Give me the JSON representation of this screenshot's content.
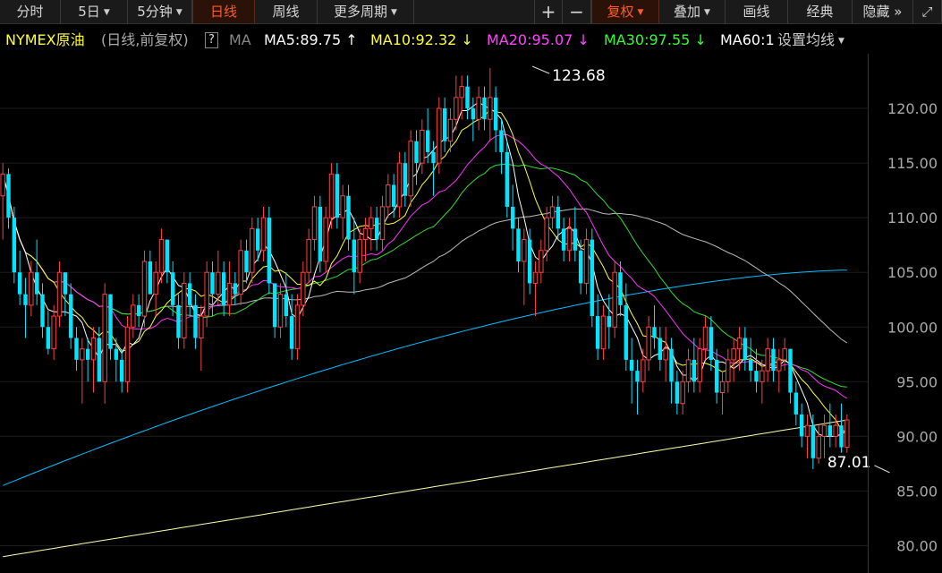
{
  "toolbar": {
    "left": [
      {
        "label": "分时"
      },
      {
        "label": "5日",
        "dropdown": true
      },
      {
        "label": "5分钟",
        "dropdown": true
      },
      {
        "label": "日线",
        "active": true
      },
      {
        "label": "周线"
      },
      {
        "label": "更多周期",
        "dropdown": true
      }
    ],
    "right": {
      "zoom_in": "+",
      "zoom_out": "−",
      "fuquan": "复权",
      "overlay": "叠加",
      "draw": "画线",
      "classic": "经典",
      "hide": "隐藏",
      "more_icon": "»",
      "fullscreen_icon": "⤢"
    }
  },
  "legend": {
    "instrument": "NYMEX原油",
    "period": "(日线,前复权)",
    "help": "?",
    "ma_label": "MA",
    "ma5": {
      "text": "MA5:89.75",
      "arrow": "↑",
      "color": "#ffffff"
    },
    "ma10": {
      "text": "MA10:92.32",
      "arrow": "↓",
      "color": "#ffff33"
    },
    "ma20": {
      "text": "MA20:95.07",
      "arrow": "↓",
      "color": "#ff33ff"
    },
    "ma30": {
      "text": "MA30:97.55",
      "arrow": "↓",
      "color": "#33ff33"
    },
    "ma60": {
      "text": "MA60:1",
      "color": "#ffffff"
    },
    "settings": "设置均线"
  },
  "colors": {
    "up": "#ff4040",
    "down": "#00e5ff",
    "ma5": "#ffffff",
    "ma10": "#ffff33",
    "ma20": "#ff33ff",
    "ma30": "#33dd33",
    "ma60": "#bbbbbb",
    "ma120": "#00bfff",
    "ma250": "#ffffaa",
    "grid": "#1c1c1c",
    "axis_text": "#aaaaaa"
  },
  "chart_data": {
    "type": "candlestick",
    "ylim": [
      77.5,
      125
    ],
    "yticks": [
      "120.00",
      "115.00",
      "110.00",
      "105.00",
      "100.00",
      "95.00",
      "90.00",
      "85.00",
      "80.00"
    ],
    "annotations": [
      {
        "text": "123.68",
        "label": "high",
        "x_index": 93,
        "value": 123.68
      },
      {
        "text": "87.01",
        "label": "low",
        "x_index": 157,
        "value": 87.01
      }
    ],
    "ohlc": [
      [
        112,
        115,
        108,
        114
      ],
      [
        114,
        114.5,
        109,
        110
      ],
      [
        110,
        111,
        104,
        105
      ],
      [
        105,
        107,
        102,
        103
      ],
      [
        103,
        104.5,
        99,
        102
      ],
      [
        102,
        106,
        101,
        105
      ],
      [
        105,
        108,
        102,
        103
      ],
      [
        103,
        104,
        99,
        100
      ],
      [
        100,
        101.5,
        97.5,
        98
      ],
      [
        98,
        102,
        97,
        101
      ],
      [
        101,
        106,
        100,
        105
      ],
      [
        105,
        105,
        101,
        103
      ],
      [
        103,
        104,
        98,
        99
      ],
      [
        99,
        100,
        96,
        97
      ],
      [
        97,
        99,
        93,
        98
      ],
      [
        98,
        99,
        95,
        97
      ],
      [
        97,
        100,
        94,
        99
      ],
      [
        99,
        100,
        95,
        95
      ],
      [
        95,
        104,
        93,
        103
      ],
      [
        103,
        103,
        97,
        98
      ],
      [
        98,
        99,
        95,
        97
      ],
      [
        97,
        98,
        94,
        95
      ],
      [
        95,
        101,
        94,
        100
      ],
      [
        100,
        103,
        99,
        102
      ],
      [
        102,
        103,
        100,
        101
      ],
      [
        101,
        107,
        100,
        106
      ],
      [
        106,
        107,
        103,
        103
      ],
      [
        103,
        106,
        101,
        105
      ],
      [
        105,
        109,
        104,
        108
      ],
      [
        108,
        108,
        104,
        105
      ],
      [
        105,
        106,
        101,
        102
      ],
      [
        102,
        103,
        98,
        99
      ],
      [
        99,
        105,
        98,
        104
      ],
      [
        104,
        105,
        101,
        102
      ],
      [
        102,
        103,
        98,
        99
      ],
      [
        99,
        102,
        96,
        101
      ],
      [
        101,
        106,
        100,
        105
      ],
      [
        105,
        106,
        101,
        103
      ],
      [
        103,
        107,
        102,
        105
      ],
      [
        105,
        106,
        101,
        102
      ],
      [
        102,
        106,
        101,
        104
      ],
      [
        104,
        105,
        102,
        103
      ],
      [
        103,
        108,
        102,
        107
      ],
      [
        107,
        108,
        104,
        105
      ],
      [
        105,
        110,
        104,
        109
      ],
      [
        109,
        110,
        106,
        107
      ],
      [
        107,
        111,
        106,
        110
      ],
      [
        110,
        111,
        103,
        104
      ],
      [
        104,
        104,
        99,
        100
      ],
      [
        100,
        104,
        99,
        103
      ],
      [
        103,
        105,
        100,
        101
      ],
      [
        101,
        103,
        97,
        98
      ],
      [
        98,
        103,
        97,
        102
      ],
      [
        102,
        106,
        101,
        105
      ],
      [
        105,
        109,
        104,
        108
      ],
      [
        108,
        112,
        107,
        111
      ],
      [
        111,
        112,
        105,
        106
      ],
      [
        106,
        111,
        105,
        110
      ],
      [
        110,
        115,
        109,
        114
      ],
      [
        114,
        115,
        109,
        110
      ],
      [
        110,
        113,
        108,
        112
      ],
      [
        112,
        113,
        107,
        108
      ],
      [
        108,
        110,
        103,
        105
      ],
      [
        105,
        109,
        104,
        108
      ],
      [
        108,
        110,
        106,
        109
      ],
      [
        109,
        111,
        107,
        110
      ],
      [
        110,
        111,
        107,
        108
      ],
      [
        108,
        112,
        107,
        111
      ],
      [
        111,
        114,
        110,
        113
      ],
      [
        113,
        114,
        110,
        111
      ],
      [
        111,
        116,
        110,
        115
      ],
      [
        115,
        116,
        111,
        112
      ],
      [
        112,
        118,
        111,
        117
      ],
      [
        117,
        118,
        113,
        115
      ],
      [
        115,
        119,
        114,
        118
      ],
      [
        118,
        120,
        115,
        116
      ],
      [
        116,
        117,
        112,
        115
      ],
      [
        115,
        121,
        114,
        120
      ],
      [
        120,
        121,
        116,
        117
      ],
      [
        117,
        120,
        116,
        119
      ],
      [
        119,
        123,
        118,
        121
      ],
      [
        121,
        123,
        119,
        122
      ],
      [
        122,
        123,
        119,
        120
      ],
      [
        120,
        121,
        117,
        119
      ],
      [
        119,
        122,
        118,
        121
      ],
      [
        121,
        122,
        118,
        119
      ],
      [
        119,
        123.68,
        117,
        121
      ],
      [
        121,
        122,
        116,
        118
      ],
      [
        118,
        119,
        114,
        116
      ],
      [
        116,
        117,
        110,
        111
      ],
      [
        111,
        113,
        107,
        109
      ],
      [
        109,
        110,
        105,
        106
      ],
      [
        106,
        109,
        102,
        108
      ],
      [
        108,
        109,
        103,
        104
      ],
      [
        104,
        106,
        101,
        105
      ],
      [
        105,
        108,
        104,
        107
      ],
      [
        107,
        111,
        106,
        110
      ],
      [
        110,
        112,
        109,
        111
      ],
      [
        111,
        112,
        108,
        109
      ],
      [
        109,
        110,
        106,
        107
      ],
      [
        107,
        110,
        106,
        109
      ],
      [
        109,
        111,
        106,
        107
      ],
      [
        107,
        108,
        103,
        104
      ],
      [
        104,
        109,
        103,
        108
      ],
      [
        108,
        109,
        100,
        101
      ],
      [
        101,
        103,
        97,
        98
      ],
      [
        98,
        102,
        97,
        101
      ],
      [
        101,
        103,
        98,
        100
      ],
      [
        100,
        106,
        99,
        105
      ],
      [
        105,
        106,
        101,
        102
      ],
      [
        102,
        104,
        96,
        97
      ],
      [
        97,
        99,
        93,
        96
      ],
      [
        96,
        97,
        92,
        95
      ],
      [
        95,
        98,
        94,
        97
      ],
      [
        97,
        101,
        96,
        100
      ],
      [
        100,
        102,
        98,
        99
      ],
      [
        99,
        100,
        96,
        97
      ],
      [
        97,
        100,
        95,
        98
      ],
      [
        98,
        99,
        93,
        95
      ],
      [
        95,
        96,
        92,
        93
      ],
      [
        93,
        96,
        92,
        95
      ],
      [
        95,
        98,
        94,
        97
      ],
      [
        97,
        99,
        94,
        95
      ],
      [
        95,
        99,
        94,
        98
      ],
      [
        98,
        101,
        97,
        100
      ],
      [
        100,
        101,
        96,
        97
      ],
      [
        97,
        98,
        93,
        94
      ],
      [
        94,
        96,
        92,
        95
      ],
      [
        95,
        98,
        94,
        97
      ],
      [
        97,
        99,
        95,
        98
      ],
      [
        98,
        100,
        96,
        99
      ],
      [
        99,
        100,
        96,
        97
      ],
      [
        97,
        99,
        95,
        96
      ],
      [
        96,
        98,
        94,
        95
      ],
      [
        95,
        97,
        93,
        96
      ],
      [
        96,
        99,
        95,
        98
      ],
      [
        98,
        99,
        95,
        96
      ],
      [
        96,
        98,
        94,
        97
      ],
      [
        97,
        99,
        96,
        98
      ],
      [
        98,
        98,
        93,
        94
      ],
      [
        94,
        95,
        91,
        92
      ],
      [
        92,
        93,
        89,
        90
      ],
      [
        90,
        92,
        88,
        91
      ],
      [
        91,
        92,
        87.01,
        88
      ],
      [
        88,
        91,
        87.5,
        90
      ],
      [
        90,
        92,
        88,
        91
      ],
      [
        91,
        93,
        89,
        90
      ],
      [
        90,
        92,
        89,
        91
      ],
      [
        91,
        93,
        88.5,
        89
      ],
      [
        89,
        92,
        88.5,
        91.5
      ]
    ],
    "ma5": [],
    "ma10": [],
    "ma20": [],
    "ma30": [],
    "ma60": [],
    "ma120_end": 105.2,
    "ma250_range": [
      79,
      91.5
    ]
  }
}
